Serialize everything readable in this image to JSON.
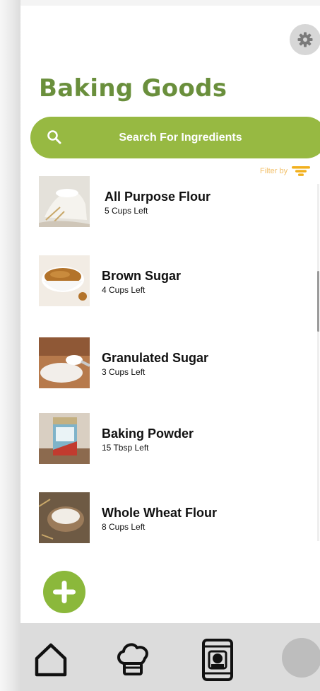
{
  "header": {
    "title": "Baking Goods",
    "settings_icon": "gear-icon"
  },
  "search": {
    "placeholder": "Search For Ingredients",
    "icon": "search-icon"
  },
  "filter": {
    "label": "Filter by",
    "icon": "filter-icon"
  },
  "ingredients": [
    {
      "name": "All Purpose Flour",
      "quantity": "5 Cups Left",
      "image": "flour-sack-photo"
    },
    {
      "name": "Brown Sugar",
      "quantity": "4 Cups Left",
      "image": "brown-sugar-bowl-photo"
    },
    {
      "name": "Granulated Sugar",
      "quantity": "3 Cups Left",
      "image": "sugar-spoon-photo"
    },
    {
      "name": "Baking Powder",
      "quantity": "15 Tbsp Left",
      "image": "baking-powder-can-photo"
    },
    {
      "name": "Whole Wheat Flour",
      "quantity": "8 Cups Left",
      "image": "flour-bowl-photo"
    }
  ],
  "add_button": {
    "icon": "plus-icon"
  },
  "nav": {
    "items": [
      "home-icon",
      "chef-hat-icon",
      "pantry-jar-icon",
      "profile-avatar"
    ]
  },
  "colors": {
    "title": "#6a8f3c",
    "search_bar": "#97b942",
    "add_button": "#8bb83b",
    "filter_accent": "#f2b01e",
    "nav_background": "#dcdcdc"
  }
}
